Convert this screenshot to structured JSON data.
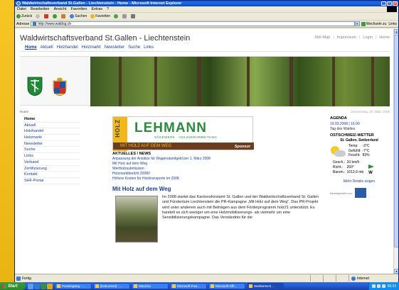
{
  "window": {
    "title": "Waldwirtschaftsverband St.Gallen - Liechtenstein - Home - Microsoft Internet Explorer"
  },
  "menu": [
    "Datei",
    "Bearbeiten",
    "Ansicht",
    "Favoriten",
    "Extras",
    "?"
  ],
  "toolbar": {
    "back": "Zurück",
    "search": "Suchen",
    "favorites": "Favoriten"
  },
  "addressbar": {
    "label": "Adresse",
    "url": "http://www.waldsg.ch",
    "go": "Wechseln zu",
    "links": "Links"
  },
  "site": {
    "title": "Waldwirtschaftsverband St.Gallen - Liechtenstein",
    "toplinks": [
      "Site-Map",
      "Impressum",
      "Login",
      "Home"
    ],
    "mainnav": [
      "Home",
      "Aktuell",
      "Holzhandel",
      "Holzmarkt",
      "Newsletter",
      "Suche",
      "Links"
    ],
    "breadcrumb": "Home",
    "date": "Donnerstag, 20. März 2008",
    "leftnav": [
      "Home",
      "Aktuell",
      "Holzhandel",
      "Holzmarkt",
      "Newsletter",
      "Suche",
      "Links",
      "Verband",
      "Zertifizierung",
      "Kontakt",
      "SHF-Portal"
    ]
  },
  "ad": {
    "stripe": "HOLZ",
    "name": "LEHMANN",
    "sub": "SÄGEWERK · HOLZVERARBEITUNG",
    "strip": "MIT HOLZ AUF DEM WEG",
    "sponsor": "Sponsor"
  },
  "news": {
    "heading": "AKTUELLES / NEWS",
    "items": [
      "Anpassung der Ansätze für Wagenstandgeld per 1. März 2008",
      "Mit Holz auf dem Weg",
      "Wertholzsubmission",
      "Holzmarktbericht 2008/I",
      "Höhere Kosten für Holztransporte im 2008"
    ]
  },
  "article": {
    "title": "Mit Holz auf dem Weg",
    "text": "Im 2008 startet das Kantonsforstamt St. Gallen und der Waldwirtschaftsverband St. Gallen und Fürstentum Liechtenstein die PR-Kampagne „Mit Holz auf dem Weg\". Das PR-Projekt wird unter anderem auch mit Beiträgen aus dem Förderprogramm holz21 unterstützt. Es handelt es sich weniger um eine Holzmobilisierungs- als vielmehr um eine Sensibilisierungskampagne. Das Verständnis für die"
  },
  "agenda": {
    "heading": "AGENDA",
    "date": "19.03.2008 | 16.00",
    "event": "Tag des Waldes"
  },
  "weather": {
    "heading": "OSTSCHWEIZ-WETTER",
    "location": "St. Gallen, Switzerland",
    "rows": [
      {
        "label": "Temp:",
        "value": "-3°C"
      },
      {
        "label": "Gefühlt:",
        "value": "-7°C"
      },
      {
        "label": "Feucht:",
        "value": "83%"
      }
    ],
    "wind": [
      {
        "label": "Gesch.:",
        "value": "10 km/h"
      },
      {
        "label": "Richt.:",
        "value": "260°"
      },
      {
        "label": "Barom.:",
        "value": "1013.9 mb"
      }
    ],
    "wind_dir": "W",
    "more": "Mehr Details zeigen",
    "sponsored": "Bereitgestellt von:"
  },
  "statusbar": {
    "status": "Fertig",
    "zone": "Internet"
  },
  "taskbar": {
    "start": "Start",
    "tasks": [
      "Posteingang - ...",
      "[Dokument] - ...",
      "Maurizio",
      "Microsoft Pow...",
      "Microsoft Offi...",
      "Waldwirtsch..."
    ],
    "clock": "08:33"
  },
  "colors": {
    "link": "#1a3f93",
    "ad_green": "#2a8a3e",
    "ad_yellow": "#f2b71a",
    "desktop": "#f6c625"
  }
}
